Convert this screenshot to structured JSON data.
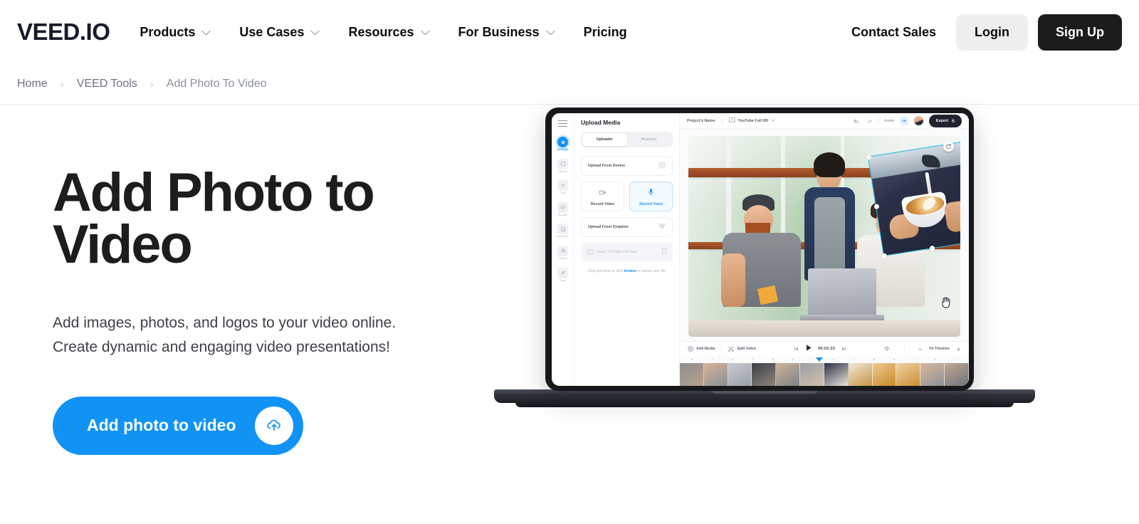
{
  "header": {
    "logo": "VEED.IO",
    "nav": [
      {
        "label": "Products",
        "has_caret": true,
        "icon": "chevron-down-icon"
      },
      {
        "label": "Use Cases",
        "has_caret": true,
        "icon": "chevron-down-icon"
      },
      {
        "label": "Resources",
        "has_caret": true,
        "icon": "chevron-down-icon"
      },
      {
        "label": "For Business",
        "has_caret": true,
        "icon": "chevron-down-icon"
      },
      {
        "label": "Pricing",
        "has_caret": false,
        "icon": ""
      }
    ],
    "contact_sales": "Contact Sales",
    "login": "Login",
    "signup": "Sign Up",
    "colors": {
      "signup_bg": "#1c1c1c",
      "login_bg": "#eeeeee",
      "text": "#0d0d0d"
    }
  },
  "breadcrumb": {
    "separator": "›",
    "items": [
      {
        "label": "Home",
        "current": false
      },
      {
        "label": "VEED Tools",
        "current": false
      },
      {
        "label": "Add Photo To Video",
        "current": true
      }
    ]
  },
  "hero": {
    "title": "Add Photo to Video",
    "subtitle_line1": "Add images, photos, and logos to your video online.",
    "subtitle_line2": "Create dynamic and engaging video presentations!",
    "cta_label": "Add photo to video",
    "cta_icon": "upload-cloud-icon",
    "cta_color": "#1093f5"
  },
  "mockup": {
    "rail": [
      {
        "label": "Settings",
        "icon": "settings-icon",
        "active": true
      },
      {
        "label": "Upload",
        "icon": "image-upload-icon",
        "active": false
      },
      {
        "label": "Text",
        "icon": "text-icon",
        "active": false
      },
      {
        "label": "Subtitle",
        "icon": "subtitle-icon",
        "active": false
      },
      {
        "label": "Elements",
        "icon": "elements-icon",
        "active": false
      },
      {
        "label": "Filters",
        "icon": "filters-icon",
        "active": false
      },
      {
        "label": "Draw",
        "icon": "pencil-icon",
        "active": false
      }
    ],
    "panel": {
      "title": "Upload Media",
      "tabs": [
        {
          "label": "Uploader",
          "active": true
        },
        {
          "label": "Branded",
          "active": false
        }
      ],
      "upload_from_device": "Upload From Device",
      "upload_from_device_icon": "cloud-upload-icon",
      "record_video": "Record Video",
      "record_video_icon": "video-camera-icon",
      "record_voice": "Record Voice",
      "record_voice_icon": "microphone-icon",
      "upload_from_dropbox": "Upload From Dropbox",
      "dropbox_icon": "dropbox-icon",
      "youtube_placeholder": "Insert YouTube Link here",
      "youtube_icon": "youtube-icon",
      "paste_icon": "clipboard-icon",
      "hint_prefix": "Drag and drop or click ",
      "hint_link": "browse",
      "hint_suffix": " to upload your file"
    },
    "topbar": {
      "project_name": "Project's Name",
      "preset": "YouTube Full HD",
      "preset_icon": "aspect-ratio-icon",
      "undo_icon": "undo-icon",
      "redo_icon": "redo-icon",
      "invite": "Invite",
      "collab_badge": "SB",
      "avatar": "user-avatar",
      "export": "Export",
      "export_icon": "download-icon"
    },
    "canvas": {
      "scene_description": "Three people smiling around a laptop in a bright cafe",
      "overlay_description": "Latte art pour photo overlay",
      "selection_color": "#1fc4f4",
      "rotate_icon": "rotate-icon",
      "cursor_icon": "grab-hand-cursor"
    },
    "timeline": {
      "add_media": "Add Media",
      "add_media_icon": "plus-circle-icon",
      "split_video": "Split Video",
      "split_icon": "scissors-icon",
      "skip_back_icon": "skip-back-icon",
      "play_icon": "play-icon",
      "skip_forward_icon": "skip-forward-icon",
      "timecode": "00:02:23",
      "volume_icon": "volume-icon",
      "zoom_out_icon": "minus-icon",
      "fit_timeline": "Fit Timeline",
      "zoom_in_icon": "plus-icon"
    }
  }
}
